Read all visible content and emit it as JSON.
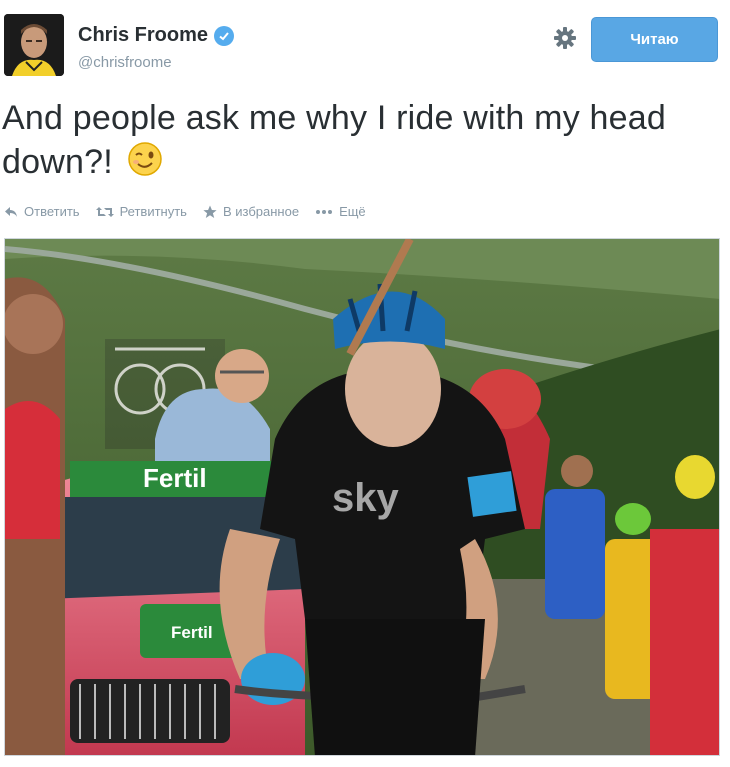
{
  "profile": {
    "display_name": "Chris Froome",
    "handle": "@chrisfroome",
    "verified": true
  },
  "header": {
    "follow_label": "Читаю"
  },
  "tweet": {
    "text": "And people ask me why I ride with my head down?!",
    "emoji": "winking-face"
  },
  "actions": [
    {
      "icon": "reply-icon",
      "label": "Ответить"
    },
    {
      "icon": "retweet-icon",
      "label": "Ретвитнуть"
    },
    {
      "icon": "star-icon",
      "label": "В избранное"
    },
    {
      "icon": "more-icon",
      "label": "Ещё"
    }
  ],
  "media": {
    "jersey_text": "sky",
    "banner_text": "Fertil",
    "grille_text": "Fertil"
  },
  "colors": {
    "follow_button": "#59a7e4",
    "verified_badge": "#55acee",
    "muted_text": "#8899a6"
  }
}
